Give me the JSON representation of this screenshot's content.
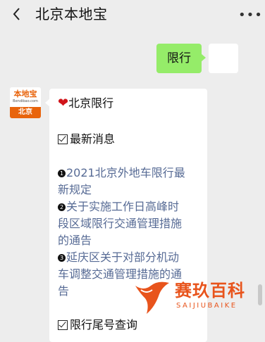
{
  "header": {
    "title": "北京本地宝",
    "more_label": "•••"
  },
  "chat": {
    "outgoing_message": "限行",
    "sender_logo": {
      "name": "本地宝",
      "url": "Bendibao.com",
      "city": "北京"
    },
    "reply": {
      "heading": "北京限行",
      "section1": "最新消息",
      "items": [
        {
          "num": "1",
          "line1": "2021北京外地车限行最",
          "line2": "新规定"
        },
        {
          "num": "2",
          "line1": "关于实施工作日高峰时",
          "line2": "段区域限行交通管理措施",
          "line3": "的通告"
        },
        {
          "num": "3",
          "line1": "延庆区关于对部分机动",
          "line2": "车调整交通管理措施的通",
          "line3": "告"
        }
      ],
      "section2": "限行尾号查询"
    }
  },
  "watermark": {
    "text": "赛玖百科",
    "sub": "SAIJIUBAIKE"
  },
  "colors": {
    "bubble_out": "#95ec69",
    "link": "#576b95",
    "brand": "#e8640c"
  }
}
